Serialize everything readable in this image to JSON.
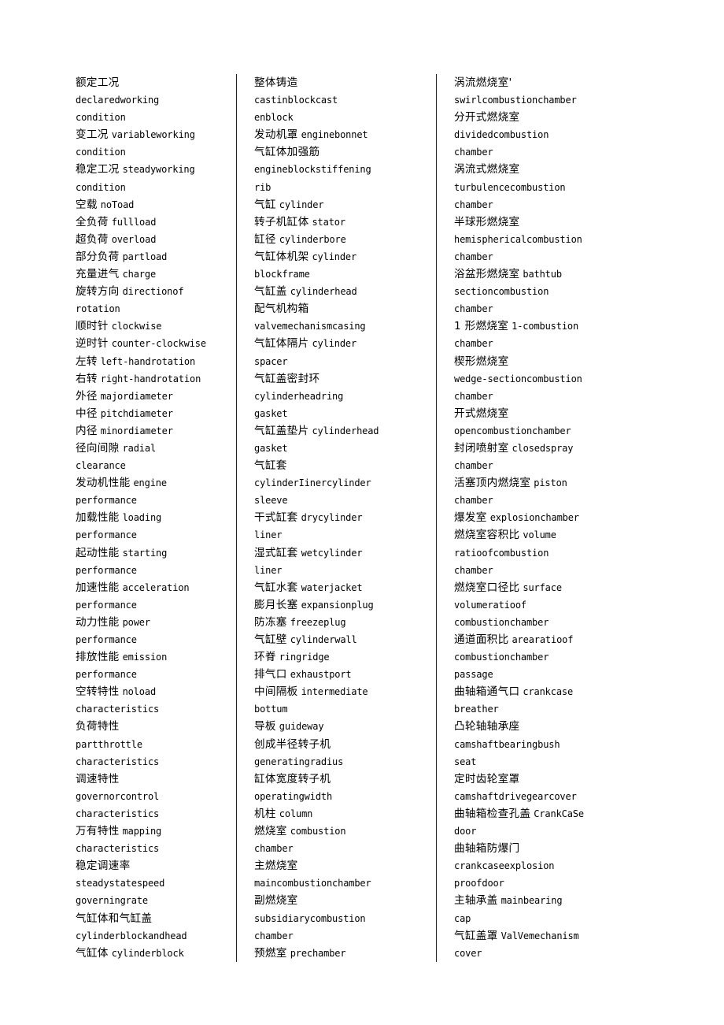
{
  "page": {
    "type": "glossary",
    "language_pair": "Chinese-English",
    "column_count": 3,
    "divider_color": "#222222",
    "background_color": "#ffffff",
    "text_color": "#000000"
  },
  "columns": [
    {
      "id": "column-1",
      "entries": [
        {
          "cn": "额定工况",
          "en": "declaredworking condition"
        },
        {
          "cn": "变工况",
          "en": "variableworking condition"
        },
        {
          "cn": "稳定工况",
          "en": "steadyworking condition"
        },
        {
          "cn": "空载",
          "en": "noToad"
        },
        {
          "cn": "全负荷",
          "en": "fullload"
        },
        {
          "cn": "超负荷",
          "en": "overload"
        },
        {
          "cn": "部分负荷",
          "en": "partload"
        },
        {
          "cn": "充量进气",
          "en": "charge"
        },
        {
          "cn": "旋转方向",
          "en": "directionof rotation"
        },
        {
          "cn": "顺时针",
          "en": "clockwise"
        },
        {
          "cn": "逆时针",
          "en": "counter-clockwise"
        },
        {
          "cn": "左转",
          "en": "left-handrotation"
        },
        {
          "cn": "右转",
          "en": "right-handrotation"
        },
        {
          "cn": "外径",
          "en": "majordiameter"
        },
        {
          "cn": "中径",
          "en": "pitchdiameter"
        },
        {
          "cn": "内径",
          "en": "minordiameter"
        },
        {
          "cn": "径向间隙",
          "en": "radial clearance"
        },
        {
          "cn": "发动机性能",
          "en": "engine performance"
        },
        {
          "cn": "加载性能",
          "en": "loading performance"
        },
        {
          "cn": "起动性能",
          "en": "starting performance"
        },
        {
          "cn": "加速性能",
          "en": "acceleration performance"
        },
        {
          "cn": "动力性能",
          "en": "power performance"
        },
        {
          "cn": "排放性能",
          "en": "emission performance"
        },
        {
          "cn": "空转特性",
          "en": "noload characteristics"
        },
        {
          "cn": "负荷特性",
          "en": "partthrottle characteristics"
        },
        {
          "cn": "调速特性",
          "en": "governorcontrol characteristics"
        },
        {
          "cn": "万有特性",
          "en": "mapping characteristics"
        },
        {
          "cn": "稳定调速率",
          "en": "steadystatespeed governingrate"
        },
        {
          "cn": "气缸体和气缸盖",
          "en": "cylinderblockandhead"
        },
        {
          "cn": "气缸体",
          "en": "cylinderblock"
        }
      ],
      "lines": [
        {
          "cn": "额定工况",
          "en": ""
        },
        {
          "cn": "",
          "en": "declaredworking"
        },
        {
          "cn": "",
          "en": "condition"
        },
        {
          "cn": "变工况",
          "en": "variableworking"
        },
        {
          "cn": "",
          "en": "condition"
        },
        {
          "cn": "稳定工况",
          "en": "steadyworking"
        },
        {
          "cn": "",
          "en": "condition"
        },
        {
          "cn": "空载",
          "en": "noToad"
        },
        {
          "cn": "全负荷",
          "en": "fullload"
        },
        {
          "cn": "超负荷",
          "en": "overload"
        },
        {
          "cn": "部分负荷",
          "en": "partload"
        },
        {
          "cn": "充量进气",
          "en": "charge"
        },
        {
          "cn": "旋转方向",
          "en": "directionof"
        },
        {
          "cn": "",
          "en": "rotation"
        },
        {
          "cn": "顺时针",
          "en": "clockwise"
        },
        {
          "cn": "逆时针",
          "en": "counter-clockwise"
        },
        {
          "cn": "左转",
          "en": "left-handrotation"
        },
        {
          "cn": "右转",
          "en": "right-handrotation"
        },
        {
          "cn": "外径",
          "en": "majordiameter"
        },
        {
          "cn": "中径",
          "en": "pitchdiameter"
        },
        {
          "cn": "内径",
          "en": "minordiameter"
        },
        {
          "cn": "径向间隙",
          "en": "radial"
        },
        {
          "cn": "",
          "en": "clearance"
        },
        {
          "cn": "发动机性能",
          "en": "engine"
        },
        {
          "cn": "",
          "en": "performance"
        },
        {
          "cn": "加载性能",
          "en": "loading"
        },
        {
          "cn": "",
          "en": "performance"
        },
        {
          "cn": "起动性能",
          "en": "starting"
        },
        {
          "cn": "",
          "en": "performance"
        },
        {
          "cn": "加速性能",
          "en": "acceleration"
        },
        {
          "cn": "",
          "en": "performance"
        },
        {
          "cn": "动力性能",
          "en": "power"
        },
        {
          "cn": "",
          "en": "performance"
        },
        {
          "cn": "排放性能",
          "en": "emission"
        },
        {
          "cn": "",
          "en": "performance"
        },
        {
          "cn": "空转特性",
          "en": "noload"
        },
        {
          "cn": "",
          "en": "characteristics"
        },
        {
          "cn": "负荷特性",
          "en": ""
        },
        {
          "cn": "",
          "en": "partthrottle"
        },
        {
          "cn": "",
          "en": "characteristics"
        },
        {
          "cn": "调速特性",
          "en": ""
        },
        {
          "cn": "",
          "en": "governorcontrol"
        },
        {
          "cn": "",
          "en": "characteristics"
        },
        {
          "cn": "万有特性",
          "en": "mapping"
        },
        {
          "cn": "",
          "en": "characteristics"
        },
        {
          "cn": "稳定调速率",
          "en": ""
        },
        {
          "cn": "",
          "en": "steadystatespeed"
        },
        {
          "cn": "",
          "en": "governingrate"
        },
        {
          "cn": "气缸体和气缸盖",
          "en": ""
        },
        {
          "cn": "",
          "en": "cylinderblockandhead"
        },
        {
          "cn": "气缸体",
          "en": "cylinderblock"
        }
      ]
    },
    {
      "id": "column-2",
      "entries": [
        {
          "cn": "整体铸造",
          "en": "castinblockcast enblock"
        },
        {
          "cn": "发动机罩",
          "en": "enginebonnet"
        },
        {
          "cn": "气缸体加强筋",
          "en": "engineblockstiffening rib"
        },
        {
          "cn": "气缸",
          "en": "cylinder"
        },
        {
          "cn": "转子机缸体",
          "en": "stator"
        },
        {
          "cn": "缸径",
          "en": "cylinderbore"
        },
        {
          "cn": "气缸体机架",
          "en": "cylinder blockframe"
        },
        {
          "cn": "气缸盖",
          "en": "cylinderhead"
        },
        {
          "cn": "配气机构箱",
          "en": "valvemechanismcasing"
        },
        {
          "cn": "气缸体隔片",
          "en": "cylinder spacer"
        },
        {
          "cn": "气缸盖密封环",
          "en": "cylinderheadring gasket"
        },
        {
          "cn": "气缸盖垫片",
          "en": "cylinderhead gasket"
        },
        {
          "cn": "气缸套",
          "en": "cylinderIinercylinder sleeve"
        },
        {
          "cn": "干式缸套",
          "en": "drycylinder liner"
        },
        {
          "cn": "湿式缸套",
          "en": "wetcylinder liner"
        },
        {
          "cn": "气缸水套",
          "en": "waterjacket"
        },
        {
          "cn": "膨月长塞",
          "en": "expansionplug"
        },
        {
          "cn": "防冻塞",
          "en": "freezeplug"
        },
        {
          "cn": "气缸壁",
          "en": "cylinderwall"
        },
        {
          "cn": "环脊",
          "en": "ringridge"
        },
        {
          "cn": "排气口",
          "en": "exhaustport"
        },
        {
          "cn": "中间隔板",
          "en": "intermediate bottum"
        },
        {
          "cn": "导板",
          "en": "guideway"
        },
        {
          "cn": "创成半径转子机",
          "en": "generatingradius"
        },
        {
          "cn": "缸体宽度转子机",
          "en": "operatingwidth"
        },
        {
          "cn": "机柱",
          "en": "column"
        },
        {
          "cn": "燃烧室",
          "en": "combustion chamber"
        },
        {
          "cn": "主燃烧室",
          "en": "maincombustionchamber"
        },
        {
          "cn": "副燃烧室",
          "en": "subsidiarycombustion chamber"
        },
        {
          "cn": "预燃室",
          "en": "prechamber"
        }
      ],
      "lines": [
        {
          "cn": "整体铸造",
          "en": ""
        },
        {
          "cn": "",
          "en": "castinblockcast"
        },
        {
          "cn": "",
          "en": "enblock"
        },
        {
          "cn": "发动机罩",
          "en": "enginebonnet"
        },
        {
          "cn": "气缸体加强筋",
          "en": ""
        },
        {
          "cn": "",
          "en": "engineblockstiffening"
        },
        {
          "cn": "",
          "en": "rib"
        },
        {
          "cn": "气缸",
          "en": "cylinder"
        },
        {
          "cn": "转子机缸体",
          "en": "stator"
        },
        {
          "cn": "缸径",
          "en": "cylinderbore"
        },
        {
          "cn": "气缸体机架",
          "en": "cylinder"
        },
        {
          "cn": "",
          "en": "blockframe"
        },
        {
          "cn": "气缸盖",
          "en": "cylinderhead"
        },
        {
          "cn": "配气机构箱",
          "en": ""
        },
        {
          "cn": "",
          "en": "valvemechanismcasing"
        },
        {
          "cn": "气缸体隔片",
          "en": "cylinder"
        },
        {
          "cn": "",
          "en": "spacer"
        },
        {
          "cn": "气缸盖密封环",
          "en": ""
        },
        {
          "cn": "",
          "en": "cylinderheadring"
        },
        {
          "cn": "",
          "en": "gasket"
        },
        {
          "cn": "气缸盖垫片",
          "en": "cylinderhead"
        },
        {
          "cn": "",
          "en": "gasket"
        },
        {
          "cn": "气缸套",
          "en": ""
        },
        {
          "cn": "",
          "en": "cylinderIinercylinder"
        },
        {
          "cn": "",
          "en": "sleeve"
        },
        {
          "cn": "干式缸套",
          "en": "drycylinder"
        },
        {
          "cn": "",
          "en": "liner"
        },
        {
          "cn": "湿式缸套",
          "en": "wetcylinder"
        },
        {
          "cn": "",
          "en": "liner"
        },
        {
          "cn": "气缸水套",
          "en": "waterjacket"
        },
        {
          "cn": "膨月长塞",
          "en": "expansionplug"
        },
        {
          "cn": "防冻塞",
          "en": "freezeplug"
        },
        {
          "cn": "气缸壁",
          "en": "cylinderwall"
        },
        {
          "cn": "环脊",
          "en": "ringridge"
        },
        {
          "cn": "排气口",
          "en": "exhaustport"
        },
        {
          "cn": "中间隔板",
          "en": "intermediate"
        },
        {
          "cn": "",
          "en": "bottum"
        },
        {
          "cn": "导板",
          "en": "guideway"
        },
        {
          "cn": "创成半径转子机",
          "en": ""
        },
        {
          "cn": "",
          "en": "generatingradius"
        },
        {
          "cn": "缸体宽度转子机",
          "en": ""
        },
        {
          "cn": "",
          "en": "operatingwidth"
        },
        {
          "cn": "机柱",
          "en": "column"
        },
        {
          "cn": "燃烧室",
          "en": "combustion"
        },
        {
          "cn": "",
          "en": "chamber"
        },
        {
          "cn": "主燃烧室",
          "en": ""
        },
        {
          "cn": "",
          "en": "maincombustionchamber"
        },
        {
          "cn": "副燃烧室",
          "en": ""
        },
        {
          "cn": "",
          "en": "subsidiarycombustion"
        },
        {
          "cn": "",
          "en": "chamber"
        },
        {
          "cn": "预燃室",
          "en": "prechamber"
        }
      ]
    },
    {
      "id": "column-3",
      "entries": [
        {
          "cn": "涡流燃烧室'",
          "en": "swirlcombustionchamber"
        },
        {
          "cn": "分开式燃烧室",
          "en": "dividedcombustion chamber"
        },
        {
          "cn": "涡流式燃烧室",
          "en": "turbulencecombustion chamber"
        },
        {
          "cn": "半球形燃烧室",
          "en": "hemisphericalcombustion chamber"
        },
        {
          "cn": "浴盆形燃烧室",
          "en": "bathtub sectioncombustion chamber"
        },
        {
          "cn": "1 形燃烧室",
          "en": "1-combustion chamber"
        },
        {
          "cn": "楔形燃烧室",
          "en": "wedge-sectioncombustion chamber"
        },
        {
          "cn": "开式燃烧室",
          "en": "opencombustionchamber"
        },
        {
          "cn": "封闭喷射室",
          "en": "closedspray chamber"
        },
        {
          "cn": "活塞顶内燃烧室",
          "en": "piston chamber"
        },
        {
          "cn": "爆发室",
          "en": "explosionchamber"
        },
        {
          "cn": "燃烧室容积比",
          "en": "volume ratioofcombustion chamber"
        },
        {
          "cn": "燃烧室口径比",
          "en": "surface volumeratioof combustionchamber"
        },
        {
          "cn": "通道面积比",
          "en": "arearatioof combustionchamber passage"
        },
        {
          "cn": "曲轴箱通气口",
          "en": "crankcase breather"
        },
        {
          "cn": "凸轮轴轴承座",
          "en": "camshaftbearingbush seat"
        },
        {
          "cn": "定时齿轮室罩",
          "en": "camshaftdrivegearcover"
        },
        {
          "cn": "曲轴箱检查孔盖",
          "en": "CrankCaSe door"
        },
        {
          "cn": "曲轴箱防爆门",
          "en": "crankcaseexplosion proofdoor"
        },
        {
          "cn": "主轴承盖",
          "en": "mainbearing cap"
        },
        {
          "cn": "气缸盖罩",
          "en": "ValVemechanism cover"
        }
      ],
      "lines": [
        {
          "cn": "涡流燃烧室'",
          "en": ""
        },
        {
          "cn": "",
          "en": "swirlcombustionchamber"
        },
        {
          "cn": "分开式燃烧室",
          "en": ""
        },
        {
          "cn": "",
          "en": "dividedcombustion"
        },
        {
          "cn": "",
          "en": "chamber"
        },
        {
          "cn": "涡流式燃烧室",
          "en": ""
        },
        {
          "cn": "",
          "en": "turbulencecombustion"
        },
        {
          "cn": "",
          "en": "chamber"
        },
        {
          "cn": "半球形燃烧室",
          "en": ""
        },
        {
          "cn": "",
          "en": "hemisphericalcombustion"
        },
        {
          "cn": "",
          "en": "chamber"
        },
        {
          "cn": "浴盆形燃烧室",
          "en": "bathtub"
        },
        {
          "cn": "",
          "en": "sectioncombustion"
        },
        {
          "cn": "",
          "en": "chamber"
        },
        {
          "cn": "1 形燃烧室",
          "en": "1-combustion"
        },
        {
          "cn": "",
          "en": "chamber"
        },
        {
          "cn": "楔形燃烧室",
          "en": ""
        },
        {
          "cn": "",
          "en": "wedge-sectioncombustion"
        },
        {
          "cn": "",
          "en": "chamber"
        },
        {
          "cn": "开式燃烧室",
          "en": ""
        },
        {
          "cn": "",
          "en": "opencombustionchamber"
        },
        {
          "cn": "封闭喷射室",
          "en": "closedspray"
        },
        {
          "cn": "",
          "en": "chamber"
        },
        {
          "cn": "活塞顶内燃烧室",
          "en": "piston"
        },
        {
          "cn": "",
          "en": "chamber"
        },
        {
          "cn": "爆发室",
          "en": "explosionchamber"
        },
        {
          "cn": "燃烧室容积比",
          "en": "volume"
        },
        {
          "cn": "",
          "en": "ratioofcombustion"
        },
        {
          "cn": "",
          "en": "chamber"
        },
        {
          "cn": "燃烧室口径比",
          "en": "surface"
        },
        {
          "cn": "",
          "en": "volumeratioof"
        },
        {
          "cn": "",
          "en": "combustionchamber"
        },
        {
          "cn": "通道面积比",
          "en": "arearatioof"
        },
        {
          "cn": "",
          "en": "combustionchamber"
        },
        {
          "cn": "",
          "en": "passage"
        },
        {
          "cn": "曲轴箱通气口",
          "en": "crankcase"
        },
        {
          "cn": "",
          "en": "breather"
        },
        {
          "cn": "凸轮轴轴承座",
          "en": ""
        },
        {
          "cn": "",
          "en": "camshaftbearingbush"
        },
        {
          "cn": "",
          "en": "seat"
        },
        {
          "cn": "定时齿轮室罩",
          "en": ""
        },
        {
          "cn": "",
          "en": "camshaftdrivegearcover"
        },
        {
          "cn": "曲轴箱检查孔盖",
          "en": "CrankCaSe"
        },
        {
          "cn": "",
          "en": "door"
        },
        {
          "cn": "曲轴箱防爆门",
          "en": ""
        },
        {
          "cn": "",
          "en": "crankcaseexplosion"
        },
        {
          "cn": "",
          "en": "proofdoor"
        },
        {
          "cn": "主轴承盖",
          "en": "mainbearing"
        },
        {
          "cn": "",
          "en": "cap"
        },
        {
          "cn": "气缸盖罩",
          "en": "ValVemechanism"
        },
        {
          "cn": "",
          "en": "cover"
        }
      ]
    }
  ]
}
